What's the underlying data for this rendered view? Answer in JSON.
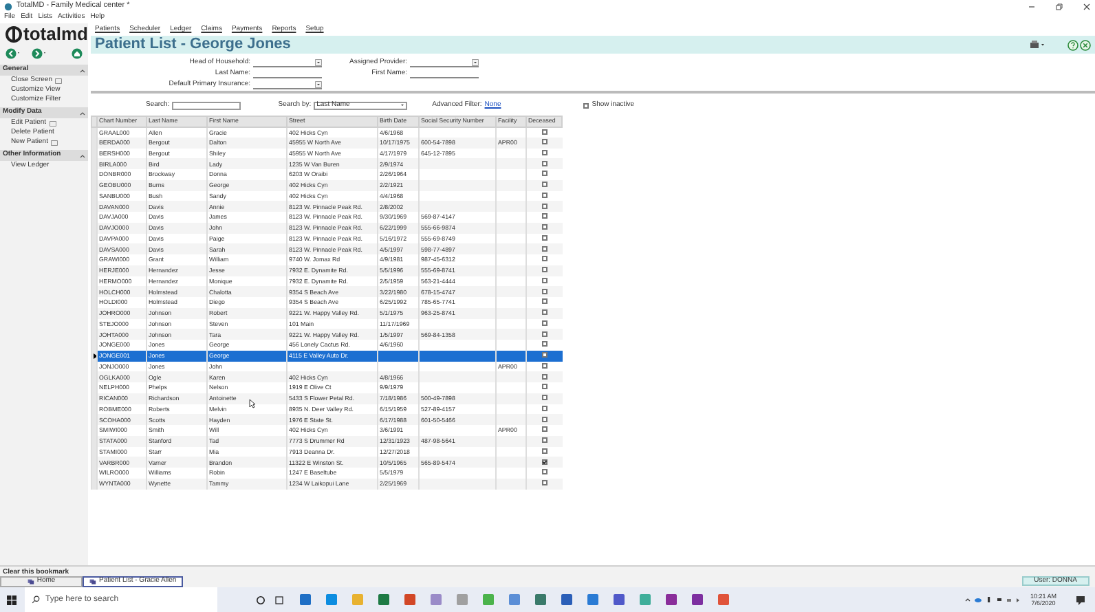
{
  "window": {
    "title": "TotalMD - Family Medical center *"
  },
  "menu_bar": [
    "File",
    "Edit",
    "Lists",
    "Activities",
    "Help"
  ],
  "logo": {
    "text": "totalmd"
  },
  "top_nav": [
    "Patients",
    "Scheduler",
    "Ledger",
    "Claims",
    "Payments",
    "Reports",
    "Setup"
  ],
  "page_title": "Patient List - George Jones",
  "sidebar": [
    {
      "title": "General",
      "items": [
        {
          "label": "Close Screen",
          "icon": true
        },
        {
          "label": "Customize View",
          "icon": false
        },
        {
          "label": "Customize Filter",
          "icon": false
        }
      ]
    },
    {
      "title": "Modify Data",
      "items": [
        {
          "label": "Edit Patient",
          "icon": true
        },
        {
          "label": "Delete Patient",
          "icon": false
        },
        {
          "label": "New Patient",
          "icon": true
        }
      ]
    },
    {
      "title": "Other Information",
      "items": [
        {
          "label": "View Ledger",
          "icon": false
        }
      ]
    }
  ],
  "form": {
    "left": [
      {
        "label": "Head of Household:",
        "kind": "dropdown"
      },
      {
        "label": "Last Name:",
        "kind": "text"
      },
      {
        "label": "Default Primary Insurance:",
        "kind": "dropdown"
      }
    ],
    "right": [
      {
        "label": "Assigned Provider:",
        "kind": "dropdown"
      },
      {
        "label": "First Name:",
        "kind": "text"
      }
    ]
  },
  "search": {
    "label": "Search:",
    "search_by_label": "Search by:",
    "search_by_value": "Last Name",
    "advanced_label": "Advanced Filter:",
    "advanced_link": "None",
    "show_inactive": {
      "label": "Show inactive",
      "checked": false
    }
  },
  "table": {
    "columns": [
      "Chart Number",
      "Last Name",
      "First Name",
      "Street",
      "Birth Date",
      "Social Security Number",
      "Facility",
      "Deceased"
    ],
    "rows": [
      {
        "cells": [
          "GRAAL000",
          "Allen",
          "Gracie",
          "402 Hicks Cyn",
          "4/6/1968",
          "",
          ""
        ],
        "deceased": false,
        "selected": false
      },
      {
        "cells": [
          "BERDA000",
          "Bergout",
          "Dalton",
          "45955 W North Ave",
          "10/17/1975",
          "600-54-7898",
          "APR00"
        ],
        "deceased": false,
        "selected": false
      },
      {
        "cells": [
          "BERSH000",
          "Bergout",
          "Shiley",
          "45955 W North Ave",
          "4/17/1979",
          "645-12-7895",
          ""
        ],
        "deceased": false,
        "selected": false
      },
      {
        "cells": [
          "BIRLA000",
          "Bird",
          "Lady",
          "1235 W Van Buren",
          "2/9/1974",
          "",
          ""
        ],
        "deceased": false,
        "selected": false
      },
      {
        "cells": [
          "DONBR000",
          "Brockway",
          "Donna",
          "6203 W Oraibi",
          "2/26/1964",
          "",
          ""
        ],
        "deceased": false,
        "selected": false
      },
      {
        "cells": [
          "GEOBU000",
          "Burns",
          "George",
          "402 Hicks Cyn",
          "2/2/1921",
          "",
          ""
        ],
        "deceased": false,
        "selected": false
      },
      {
        "cells": [
          "SANBU000",
          "Bush",
          "Sandy",
          "402 Hicks Cyn",
          "4/4/1968",
          "",
          ""
        ],
        "deceased": false,
        "selected": false
      },
      {
        "cells": [
          "DAVAN000",
          "Davis",
          "Annie",
          "8123 W. Pinnacle Peak Rd.",
          "2/8/2002",
          "",
          ""
        ],
        "deceased": false,
        "selected": false
      },
      {
        "cells": [
          "DAVJA000",
          "Davis",
          "James",
          "8123 W. Pinnacle Peak Rd.",
          "9/30/1969",
          "569-87-4147",
          ""
        ],
        "deceased": false,
        "selected": false
      },
      {
        "cells": [
          "DAVJO000",
          "Davis",
          "John",
          "8123 W. Pinnacle Peak Rd.",
          "6/22/1999",
          "555-66-9874",
          ""
        ],
        "deceased": false,
        "selected": false
      },
      {
        "cells": [
          "DAVPA000",
          "Davis",
          "Paige",
          "8123 W. Pinnacle Peak Rd.",
          "5/16/1972",
          "555-69-8749",
          ""
        ],
        "deceased": false,
        "selected": false
      },
      {
        "cells": [
          "DAVSA000",
          "Davis",
          "Sarah",
          "8123 W. Pinnacle Peak Rd.",
          "4/5/1997",
          "598-77-4897",
          ""
        ],
        "deceased": false,
        "selected": false
      },
      {
        "cells": [
          "GRAWI000",
          "Grant",
          "William",
          "9740 W. Jomax Rd",
          "4/9/1981",
          "987-45-6312",
          ""
        ],
        "deceased": false,
        "selected": false
      },
      {
        "cells": [
          "HERJE000",
          "Hernandez",
          "Jesse",
          "7932 E. Dynamite Rd.",
          "5/5/1996",
          "555-69-8741",
          ""
        ],
        "deceased": false,
        "selected": false
      },
      {
        "cells": [
          "HERMO000",
          "Hernandez",
          "Monique",
          "7932 E. Dynamite Rd.",
          "2/5/1959",
          "563-21-4444",
          ""
        ],
        "deceased": false,
        "selected": false
      },
      {
        "cells": [
          "HOLCH000",
          "Holmstead",
          "Chalotta",
          "9354 S Beach Ave",
          "3/22/1980",
          "678-15-4747",
          ""
        ],
        "deceased": false,
        "selected": false
      },
      {
        "cells": [
          "HOLDI000",
          "Holmstead",
          "Diego",
          "9354 S Beach Ave",
          "6/25/1992",
          "785-65-7741",
          ""
        ],
        "deceased": false,
        "selected": false
      },
      {
        "cells": [
          "JOHRO000",
          "Johnson",
          "Robert",
          "9221 W. Happy Valley Rd.",
          "5/1/1975",
          "963-25-8741",
          ""
        ],
        "deceased": false,
        "selected": false
      },
      {
        "cells": [
          "STEJO000",
          "Johnson",
          "Steven",
          "101 Main",
          "11/17/1969",
          "",
          ""
        ],
        "deceased": false,
        "selected": false
      },
      {
        "cells": [
          "JOHTA000",
          "Johnson",
          "Tara",
          "9221 W. Happy Valley Rd.",
          "1/5/1997",
          "569-84-1358",
          ""
        ],
        "deceased": false,
        "selected": false
      },
      {
        "cells": [
          "JONGE000",
          "Jones",
          "George",
          "456 Lonely Cactus Rd.",
          "4/6/1960",
          "",
          ""
        ],
        "deceased": false,
        "selected": false
      },
      {
        "cells": [
          "JONGE001",
          "Jones",
          "George",
          "4115 E Valley Auto Dr.",
          "",
          "",
          ""
        ],
        "deceased": false,
        "selected": true
      },
      {
        "cells": [
          "JONJO000",
          "Jones",
          "John",
          "",
          "",
          "",
          "APR00"
        ],
        "deceased": false,
        "selected": false
      },
      {
        "cells": [
          "OGLKA000",
          "Ogle",
          "Karen",
          "402 Hicks Cyn",
          "4/8/1966",
          "",
          ""
        ],
        "deceased": false,
        "selected": false
      },
      {
        "cells": [
          "NELPH000",
          "Phelps",
          "Nelson",
          "1919 E Olive Ct",
          "9/9/1979",
          "",
          ""
        ],
        "deceased": false,
        "selected": false
      },
      {
        "cells": [
          "RICAN000",
          "Richardson",
          "Antoinette",
          "5433 S Flower Petal Rd.",
          "7/18/1986",
          "500-49-7898",
          ""
        ],
        "deceased": false,
        "selected": false
      },
      {
        "cells": [
          "ROBME000",
          "Roberts",
          "Melvin",
          "8935 N. Deer Valley Rd.",
          "6/15/1959",
          "527-89-4157",
          ""
        ],
        "deceased": false,
        "selected": false
      },
      {
        "cells": [
          "SCOHA000",
          "Scotts",
          "Hayden",
          "1976 E State St.",
          "6/17/1988",
          "601-50-5466",
          ""
        ],
        "deceased": false,
        "selected": false
      },
      {
        "cells": [
          "SMIWI000",
          "Smith",
          "Will",
          "402 Hicks Cyn",
          "3/6/1991",
          "",
          "APR00"
        ],
        "deceased": false,
        "selected": false
      },
      {
        "cells": [
          "STATA000",
          "Stanford",
          "Tad",
          "7773 S Drummer Rd",
          "12/31/1923",
          "487-98-5641",
          ""
        ],
        "deceased": false,
        "selected": false
      },
      {
        "cells": [
          "STAMI000",
          "Starr",
          "Mia",
          "7913 Deanna Dr.",
          "12/27/2018",
          "",
          ""
        ],
        "deceased": false,
        "selected": false
      },
      {
        "cells": [
          "VARBR000",
          "Varner",
          "Brandon",
          "11322 E Winston St.",
          "10/5/1965",
          "565-89-5474",
          ""
        ],
        "deceased": true,
        "selected": false
      },
      {
        "cells": [
          "WILRO000",
          "Williams",
          "Robin",
          "1247 E Baseltube",
          "5/5/1979",
          "",
          ""
        ],
        "deceased": false,
        "selected": false
      },
      {
        "cells": [
          "WYNTA000",
          "Wynette",
          "Tammy",
          "1234 W Laikopui Lane",
          "2/25/1969",
          "",
          ""
        ],
        "deceased": false,
        "selected": false
      }
    ]
  },
  "bookmarks": {
    "clear_label": "Clear this bookmark",
    "tabs": [
      {
        "label": "Home",
        "selected": false
      },
      {
        "label": "Patient List - Gracie Allen",
        "selected": true
      }
    ]
  },
  "status": {
    "user": "User: DONNA"
  },
  "taskbar": {
    "search_placeholder": "Type here to search",
    "time": "10:21 AM",
    "date": "7/6/2020",
    "apps": [
      {
        "color": "#1f6fc5"
      },
      {
        "color": "#0c8de0"
      },
      {
        "color": "#e8b230"
      },
      {
        "color": "#1d7a44"
      },
      {
        "color": "#d24726"
      },
      {
        "color": "#9a8bc8"
      },
      {
        "color": "#a0a0a0"
      },
      {
        "color": "#4bb34b"
      },
      {
        "color": "#5b8ed6"
      },
      {
        "color": "#3a7a6a"
      },
      {
        "color": "#2b5fb8"
      },
      {
        "color": "#2a7bd4"
      },
      {
        "color": "#5059c9"
      },
      {
        "color": "#3fae9a"
      },
      {
        "color": "#8a2e9a"
      },
      {
        "color": "#7d2fa0"
      },
      {
        "color": "#e0533a"
      }
    ]
  }
}
